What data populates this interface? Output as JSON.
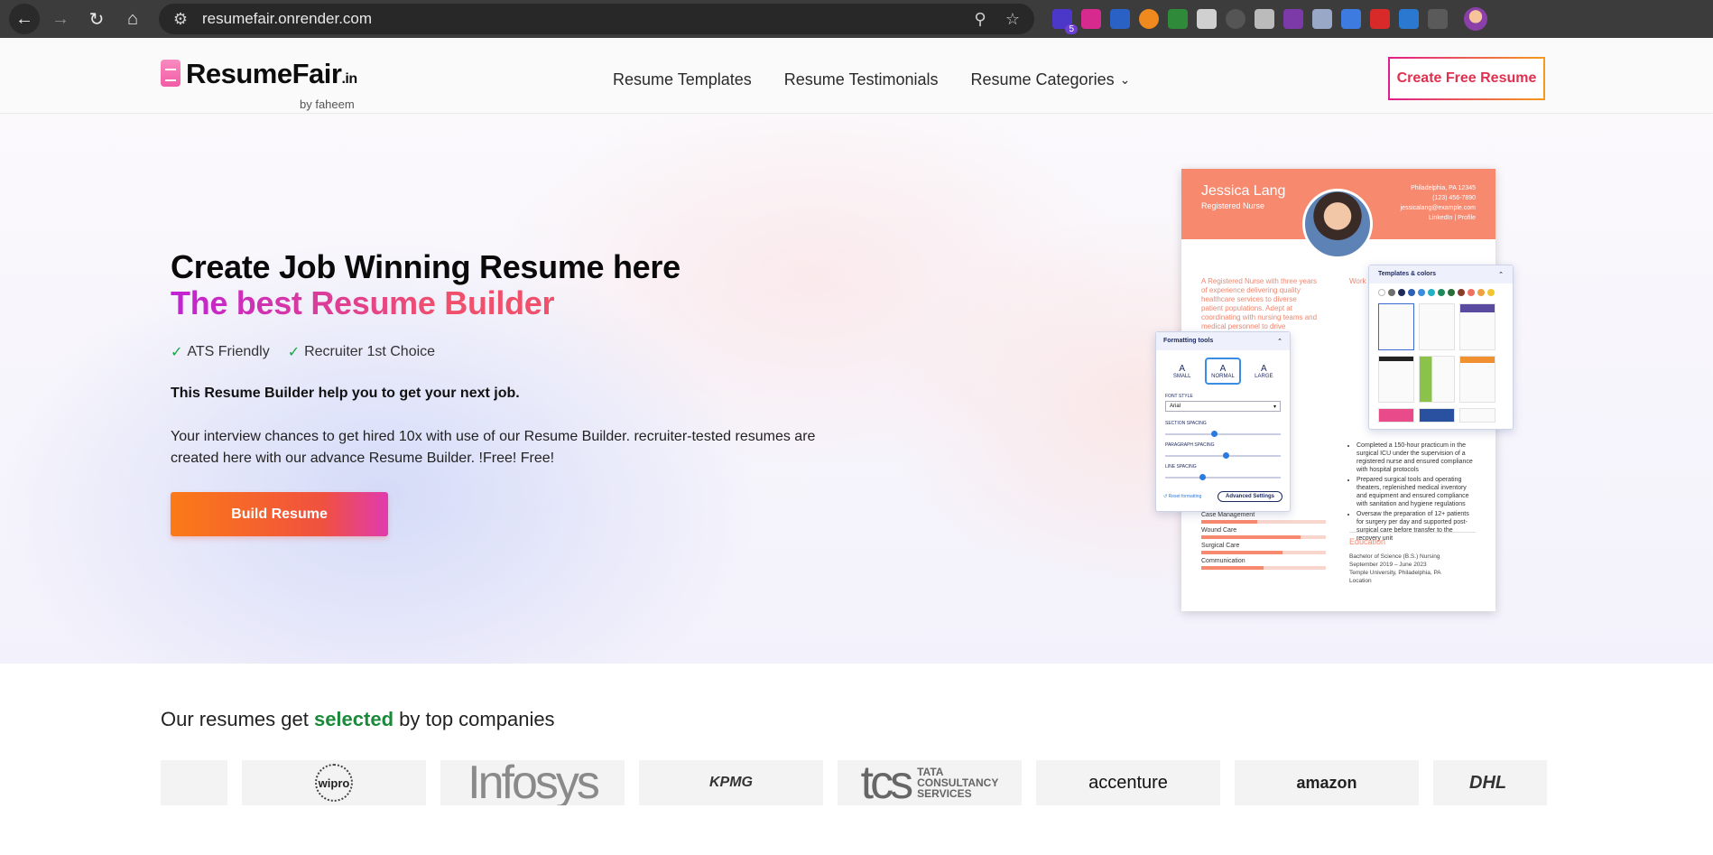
{
  "browser": {
    "url": "resumefair.onrender.com",
    "extension_badge": "5"
  },
  "header": {
    "logo_text": "ResumeFair",
    "logo_tld": ".in",
    "logo_by": "by faheem",
    "nav": [
      {
        "label": "Resume Templates"
      },
      {
        "label": "Resume Testimonials"
      },
      {
        "label": "Resume Categories"
      }
    ],
    "cta_label": "Create Free Resume"
  },
  "hero": {
    "title": "Create Job Winning Resume here",
    "subtitle": "The best Resume Builder",
    "badges": [
      "ATS Friendly",
      "Recruiter 1st Choice"
    ],
    "lead": "This Resume Builder help you to get your next job.",
    "body": "Your interview chances to get hired 10x with use of our Resume Builder. recruiter-tested resumes are created here with our advance Resume Builder. !Free! Free!",
    "button_label": "Build Resume"
  },
  "mockup": {
    "name": "Jessica Lang",
    "role": "Registered Nurse",
    "contact": [
      "Philadelphia, PA 12345",
      "(123) 456-7890",
      "jessicalang@example.com",
      "LinkedIn | Profile"
    ],
    "summary": "A Registered Nurse with three years of experience delivering quality healthcare services to diverse patient populations. Adept at coordinating with nursing teams and medical personnel to drive",
    "work_title": "Work",
    "bullets": [
      "Completed a 150-hour practicum in the surgical ICU under the supervision of a registered nurse and ensured compliance with hospital protocols",
      "Prepared surgical tools and operating theaters, replenished medical inventory and equipment and ensured compliance with sanitation and hygiene regulations",
      "Oversaw the preparation of 12+ patients for surgery per day and supported post-surgical care before transfer to the recovery unit"
    ],
    "education_title": "Education",
    "education": [
      "Bachelor of Science (B.S.) Nursing",
      "September 2019 – June 2023",
      "Temple University, Philadelphia, PA",
      "Location"
    ],
    "skills": [
      {
        "label": "Case Management",
        "level": 0.45
      },
      {
        "label": "Wound Care",
        "level": 0.8
      },
      {
        "label": "Surgical Care",
        "level": 0.65
      },
      {
        "label": "Communication",
        "level": 0.5
      }
    ],
    "templates_panel_title": "Templates & colors",
    "swatch_colors": [
      "#ffffff",
      "#6e6e6e",
      "#1e2a5a",
      "#2d5fb5",
      "#3a8de0",
      "#24b0c4",
      "#1e8a5a",
      "#2a6d3a",
      "#8c3b2b",
      "#f07060",
      "#f0a040",
      "#f2c630"
    ],
    "formatting_panel_title": "Formatting tools",
    "sizes": [
      {
        "glyph": "A",
        "label": "SMALL"
      },
      {
        "glyph": "A",
        "label": "NORMAL"
      },
      {
        "glyph": "A",
        "label": "LARGE"
      }
    ],
    "font_style_label": "FONT STYLE",
    "font_value": "Arial",
    "section_spacing_label": "SECTION SPACING",
    "paragraph_spacing_label": "PARAGRAPH SPACING",
    "line_spacing_label": "LINE SPACING",
    "reset_label": "Reset formatting",
    "advanced_label": "Advanced Settings"
  },
  "companies": {
    "title_pre": "Our resumes get ",
    "title_highlight": "selected",
    "title_post": " by top companies",
    "logos": [
      "wipro",
      "Infosys",
      "KPMG",
      "tcs",
      "TATA",
      "CONSULTANCY",
      "SERVICES",
      "accenture",
      "amazon",
      "DHL"
    ]
  },
  "colors": {
    "accent_pink": "#e01e8c",
    "accent_orange": "#fb7a17",
    "check_green": "#1aa34a",
    "highlight_green": "#1a8a3a"
  }
}
